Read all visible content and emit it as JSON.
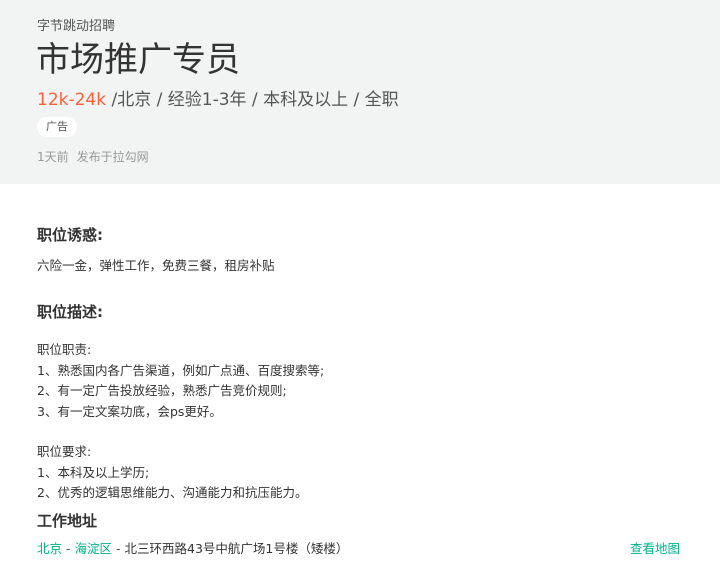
{
  "header": {
    "company": "字节跳动招聘",
    "title": "市场推广专员",
    "salary": "12k-24k",
    "meta": [
      "/北京 /",
      "经验1-3年 /",
      "本科及以上 /",
      "全职"
    ],
    "tag": "广告",
    "publish_time": "1天前",
    "publish_source": "发布于拉勾网"
  },
  "perks": {
    "title": "职位诱惑:",
    "text": "六险一金，弹性工作，免费三餐，租房补贴"
  },
  "description": {
    "title": "职位描述:",
    "duties_title": "职位职责:",
    "duties": [
      "1、熟悉国内各广告渠道，例如广点通、百度搜索等;",
      "2、有一定广告投放经验，熟悉广告竞价规则;",
      "3、有一定文案功底，会ps更好。"
    ],
    "requirements_title": "职位要求:",
    "requirements": [
      "1、本科及以上学历;",
      "2、优秀的逻辑思维能力、沟通能力和抗压能力。"
    ]
  },
  "address": {
    "title": "工作地址",
    "city": "北京",
    "district": "海淀区",
    "separator": "-",
    "detail": "北三环西路43号中航广场1号楼（矮楼）",
    "map_link": "查看地图"
  },
  "colors": {
    "salary": "#fd5f39",
    "link": "#00b38a",
    "header_bg": "#f2f3f3"
  }
}
